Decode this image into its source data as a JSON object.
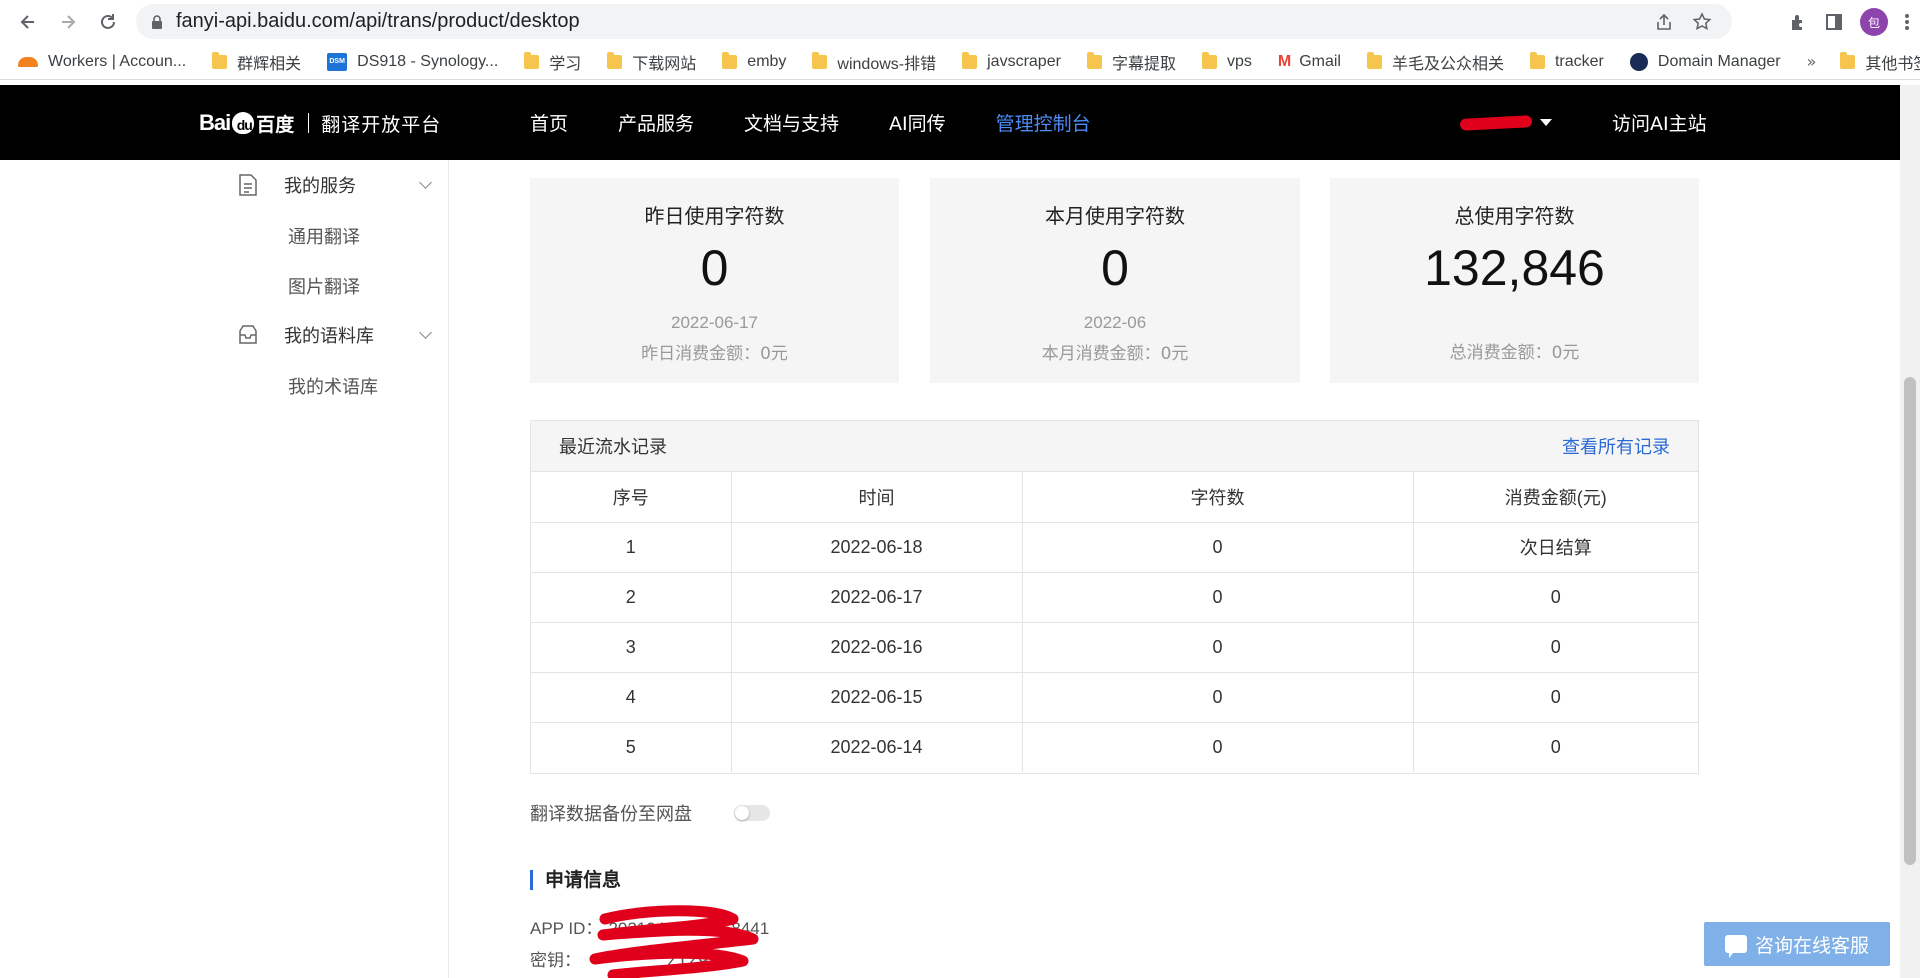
{
  "browser": {
    "url": "fanyi-api.baidu.com/api/trans/product/desktop",
    "profile_initial": "包",
    "bookmarks": [
      {
        "label": "Workers | Accoun...",
        "icon": "cloudflare-icon"
      },
      {
        "label": "群辉相关",
        "icon": "folder-icon"
      },
      {
        "label": "DS918 - Synology...",
        "icon": "dsm-icon"
      },
      {
        "label": "学习",
        "icon": "folder-icon"
      },
      {
        "label": "下载网站",
        "icon": "folder-icon"
      },
      {
        "label": "emby",
        "icon": "folder-icon"
      },
      {
        "label": "windows-排错",
        "icon": "folder-icon"
      },
      {
        "label": "javscraper",
        "icon": "folder-icon"
      },
      {
        "label": "字幕提取",
        "icon": "folder-icon"
      },
      {
        "label": "vps",
        "icon": "folder-icon"
      },
      {
        "label": "Gmail",
        "icon": "gmail-icon"
      },
      {
        "label": "羊毛及公众相关",
        "icon": "folder-icon"
      },
      {
        "label": "tracker",
        "icon": "folder-icon"
      },
      {
        "label": "Domain Manager",
        "icon": "domain-manager-icon"
      }
    ],
    "more_bookmarks": "»",
    "other_bookmarks": "其他书签"
  },
  "header": {
    "logo_bai": "Bai",
    "logo_du": "du",
    "logo_cn": "百度",
    "platform": "翻译开放平台",
    "nav": [
      "首页",
      "产品服务",
      "文档与支持",
      "AI同传",
      "管理控制台"
    ],
    "active_nav": "管理控制台",
    "visit_ai": "访问AI主站"
  },
  "sidebar": {
    "groups": [
      {
        "label": "我的服务",
        "items": [
          "通用翻译",
          "图片翻译"
        ]
      },
      {
        "label": "我的语料库",
        "items": [
          "我的术语库"
        ]
      }
    ]
  },
  "stats": {
    "yesterday": {
      "title": "昨日使用字符数",
      "value": "0",
      "date": "2022-06-17",
      "amount": "昨日消费金额：0元"
    },
    "month": {
      "title": "本月使用字符数",
      "value": "0",
      "date": "2022-06",
      "amount": "本月消费金额：0元"
    },
    "total": {
      "title": "总使用字符数",
      "value": "132,846",
      "amount": "总消费金额：0元"
    }
  },
  "records": {
    "title": "最近流水记录",
    "view_all": "查看所有记录",
    "columns": [
      "序号",
      "时间",
      "字符数",
      "消费金额(元)"
    ],
    "rows": [
      [
        "1",
        "2022-06-18",
        "0",
        "次日结算"
      ],
      [
        "2",
        "2022-06-17",
        "0",
        "0"
      ],
      [
        "3",
        "2022-06-16",
        "0",
        "0"
      ],
      [
        "4",
        "2022-06-15",
        "0",
        "0"
      ],
      [
        "5",
        "2022-06-14",
        "0",
        "0"
      ]
    ]
  },
  "backup": {
    "label": "翻译数据备份至网盘",
    "enabled": false
  },
  "app_info": {
    "title": "申请信息",
    "app_id_label": "APP ID：",
    "app_id_value": "20210420000758441",
    "key_label": "密钥：",
    "key_value": "ZTZ93_"
  },
  "service_button": "咨询在线客服",
  "colors": {
    "accent": "#2a6ad6",
    "active_nav": "#4b8cf5",
    "header_bg": "#000000",
    "card_bg": "#f5f5f5",
    "redaction": "#e0001b"
  }
}
